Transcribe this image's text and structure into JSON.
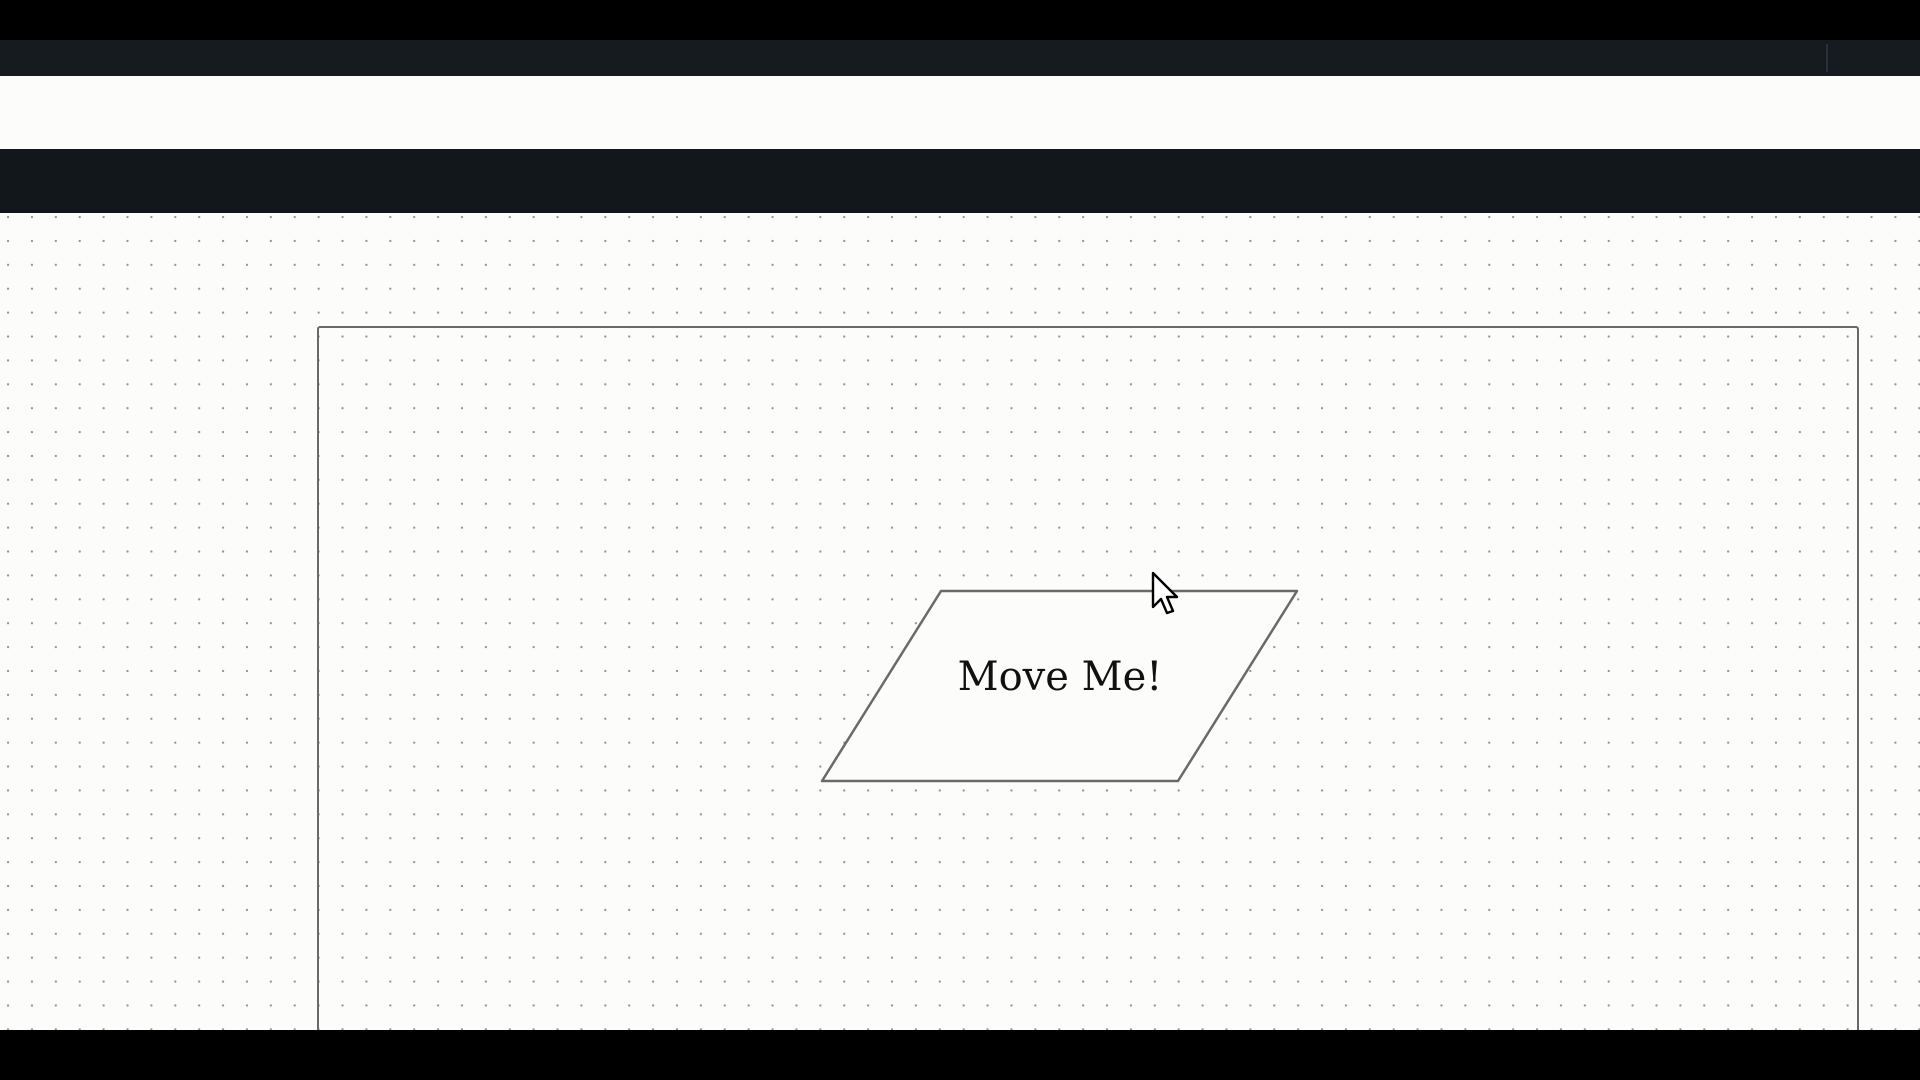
{
  "canvas": {
    "shape": {
      "type": "parallelogram",
      "label": "Move Me!"
    }
  },
  "cursor": {
    "icon": "mouse-pointer-icon"
  },
  "colors": {
    "canvas_background": "#fcfcfb",
    "toolbar_background": "#12171b",
    "grid_dot": "#8f9499",
    "shape_stroke": "#6a6a6a"
  }
}
